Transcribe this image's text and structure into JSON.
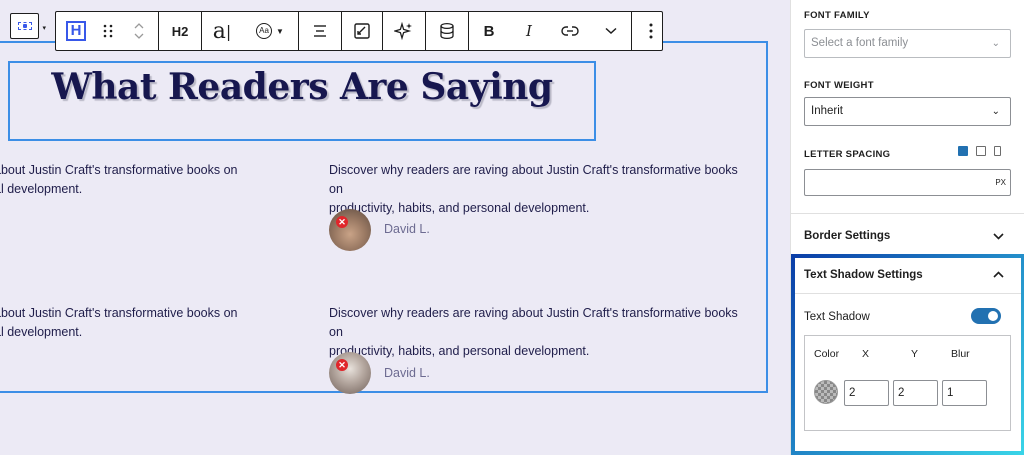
{
  "heading": {
    "text": "What Readers Are Saying"
  },
  "reviews": {
    "left_row1_line1": "about Justin Craft's transformative books on",
    "left_row1_line2": "al development.",
    "left_row2_line1": "about Justin Craft's transformative books on",
    "left_row2_line2": "al development.",
    "right_row1_line1": "Discover why readers are raving about Justin Craft's transformative books on",
    "right_row1_line2": "productivity, habits, and personal development.",
    "right_row2_line1": "Discover why readers are raving about Justin Craft's transformative books on",
    "right_row2_line2": "productivity, habits, and personal development.",
    "author1": "David L.",
    "author2": "David L."
  },
  "toolbar": {
    "heading_icon": "H",
    "level": "H2",
    "typography_glyph": "a",
    "font_size_glyph": "Aa",
    "bold": "B",
    "italic": "I"
  },
  "sidebar": {
    "font_family_label": "FONT FAMILY",
    "font_family_placeholder": "Select a font family",
    "font_weight_label": "FONT WEIGHT",
    "font_weight_value": "Inherit",
    "letter_spacing_label": "LETTER SPACING",
    "letter_spacing_unit": "PX",
    "border_settings": "Border Settings",
    "text_shadow_settings": "Text Shadow Settings",
    "text_shadow_label": "Text Shadow",
    "text_shadow_enabled": true,
    "cols": {
      "color": "Color",
      "x": "X",
      "y": "Y",
      "blur": "Blur"
    },
    "values": {
      "x": "2",
      "y": "2",
      "blur": "1"
    }
  },
  "colors": {
    "accent": "#3858e9",
    "selection": "#3c8ee6",
    "heading": "#17174f",
    "toggle": "#2271b1",
    "canvas_bg": "#eceaf5"
  },
  "icons": {
    "block_switcher": "block-icon",
    "drag": "drag-handle-icon",
    "move": "chevron-up-down-icon",
    "align": "align-icon",
    "image": "edit-image-icon",
    "ai": "sparkle-icon",
    "database": "database-icon",
    "link": "link-icon",
    "more": "chevron-down-icon",
    "options": "vertical-ellipsis-icon"
  }
}
